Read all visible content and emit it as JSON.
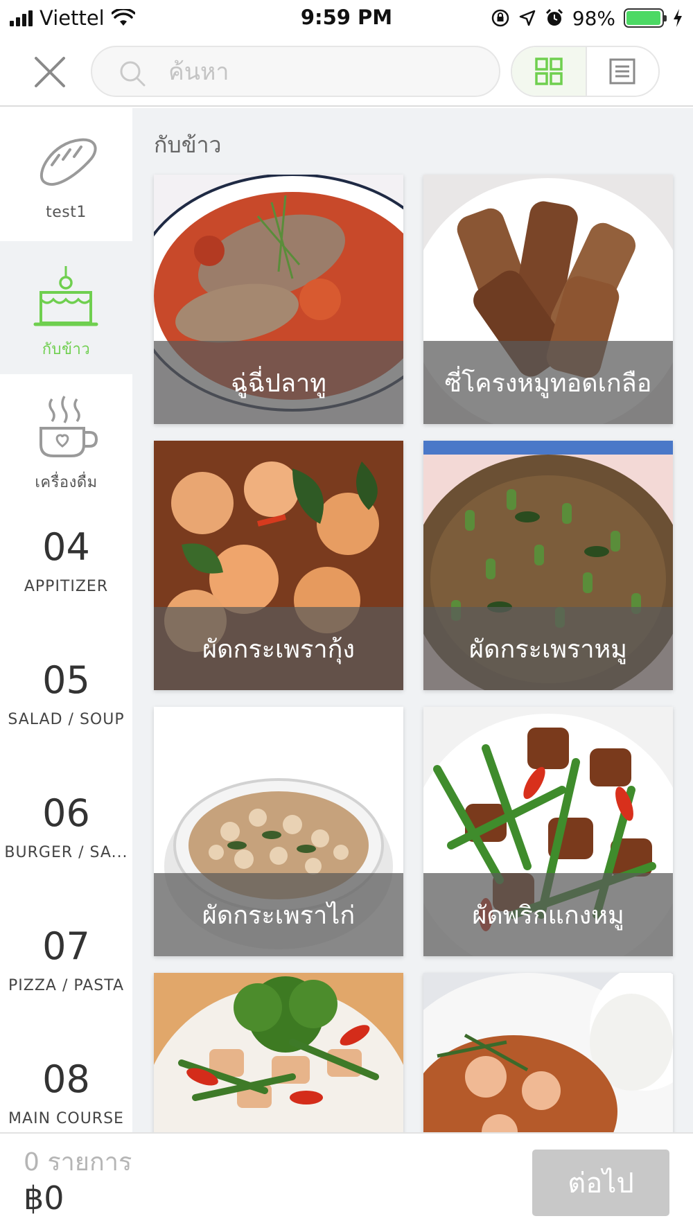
{
  "status_bar": {
    "carrier": "Viettel",
    "time": "9:59 PM",
    "battery_percent": "98%",
    "battery_level": 0.98
  },
  "header": {
    "search": {
      "placeholder": "ค้นหา",
      "value": ""
    },
    "view_mode": "grid",
    "accent_color": "#6fcf4f"
  },
  "sidebar": {
    "items": [
      {
        "label": "test1",
        "icon": "bread-icon"
      },
      {
        "label": "กับข้าว",
        "icon": "cake-icon",
        "active": true
      },
      {
        "label": "เครื่องดื่ม",
        "icon": "coffee-cup-icon"
      },
      {
        "number": "04",
        "label": "APPITIZER"
      },
      {
        "number": "05",
        "label": "SALAD / SOUP"
      },
      {
        "number": "06",
        "label": "BURGER / SA..."
      },
      {
        "number": "07",
        "label": "PIZZA / PASTA"
      },
      {
        "number": "08",
        "label": "MAIN COURSE"
      }
    ]
  },
  "content": {
    "section_title": "กับข้าว",
    "menu_items": [
      {
        "name": "ฉู่ฉี่ปลาทู"
      },
      {
        "name": "ซี่โครงหมูทอดเกลือ"
      },
      {
        "name": "ผัดกระเพรากุ้ง"
      },
      {
        "name": "ผัดกระเพราหมู"
      },
      {
        "name": "ผัดกระเพราไก่"
      },
      {
        "name": "ผัดพริกแกงหมู"
      },
      {
        "name": ""
      },
      {
        "name": ""
      }
    ]
  },
  "footer": {
    "item_count": "0 รายการ",
    "total": "฿0",
    "next_label": "ต่อไป"
  }
}
